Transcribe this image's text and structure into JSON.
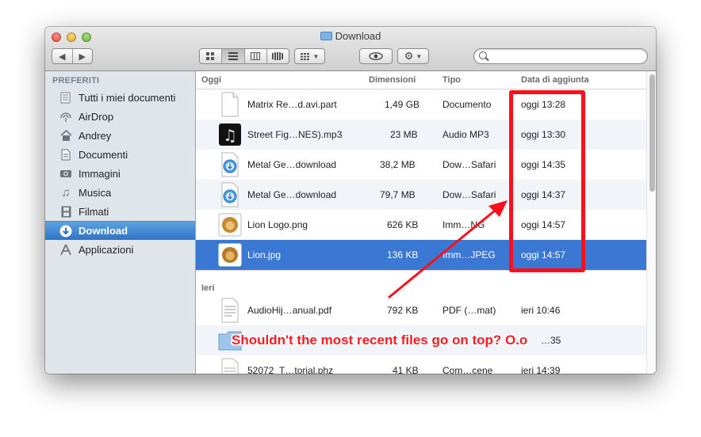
{
  "window": {
    "title": "Download"
  },
  "toolbar": {
    "back_icon": "chevron-left-icon",
    "forward_icon": "chevron-right-icon",
    "view_icons": [
      "icon-view-icon",
      "list-view-icon",
      "column-view-icon",
      "coverflow-view-icon"
    ],
    "active_view": "list-view-icon",
    "arrange_icon": "arrange-grid-icon",
    "quicklook_icon": "eye-icon",
    "action_icon": "gear-icon",
    "search": {
      "placeholder": "",
      "value": ""
    }
  },
  "sidebar": {
    "header": "PREFERITI",
    "items": [
      {
        "label": "Tutti i miei documenti",
        "icon": "all-documents-icon",
        "selected": false
      },
      {
        "label": "AirDrop",
        "icon": "airdrop-icon",
        "selected": false
      },
      {
        "label": "Andrey",
        "icon": "home-icon",
        "selected": false
      },
      {
        "label": "Documenti",
        "icon": "documents-icon",
        "selected": false
      },
      {
        "label": "Immagini",
        "icon": "camera-icon",
        "selected": false
      },
      {
        "label": "Musica",
        "icon": "music-note-icon",
        "selected": false
      },
      {
        "label": "Filmati",
        "icon": "film-icon",
        "selected": false
      },
      {
        "label": "Download",
        "icon": "download-arrow-icon",
        "selected": true
      },
      {
        "label": "Applicazioni",
        "icon": "applications-icon",
        "selected": false
      }
    ]
  },
  "list": {
    "columns": [
      "Oggi",
      "Dimensioni",
      "Tipo",
      "Data di aggiunta"
    ],
    "groups": [
      {
        "label": "Oggi",
        "rows": [
          {
            "name": "Matrix Re…d.avi.part",
            "size": "1,49 GB",
            "kind": "Documento",
            "date": "oggi 13:28",
            "icon": "blank-document-icon",
            "selected": false
          },
          {
            "name": "Street Fig…NES).mp3",
            "size": "23 MB",
            "kind": "Audio MP3",
            "date": "oggi 13:30",
            "icon": "music-file-icon",
            "selected": false
          },
          {
            "name": "Metal Ge…download",
            "size": "38,2 MB",
            "kind": "Dow…Safari",
            "date": "oggi 14:35",
            "icon": "safari-download-icon",
            "selected": false
          },
          {
            "name": "Metal Ge…download",
            "size": "79,7 MB",
            "kind": "Dow…Safari",
            "date": "oggi 14:37",
            "icon": "safari-download-icon",
            "selected": false
          },
          {
            "name": "Lion Logo.png",
            "size": "626 KB",
            "kind": "Imm…NG",
            "date": "oggi 14:57",
            "icon": "lion-image-icon",
            "selected": false
          },
          {
            "name": "Lion.jpg",
            "size": "136 KB",
            "kind": "Imm…JPEG",
            "date": "oggi 14:57",
            "icon": "lion-image-icon",
            "selected": true
          }
        ]
      },
      {
        "label": "Ieri",
        "rows": [
          {
            "name": "AudioHij…anual.pdf",
            "size": "792 KB",
            "kind": "PDF (…mat)",
            "date": "ieri 10:46",
            "icon": "pdf-document-icon",
            "selected": false
          },
          {
            "name": "",
            "size": "",
            "kind": "",
            "date": "…35",
            "icon": "folder-icon",
            "selected": false
          },
          {
            "name": "52072_T…torial.phz",
            "size": "41 KB",
            "kind": "Com…cene",
            "date": "ieri 14:39",
            "icon": "document-icon",
            "selected": false
          }
        ]
      }
    ]
  },
  "annotation": {
    "caption": "Shouldn't the most recent files go on top? O.o",
    "color": "#ff0f1b"
  }
}
